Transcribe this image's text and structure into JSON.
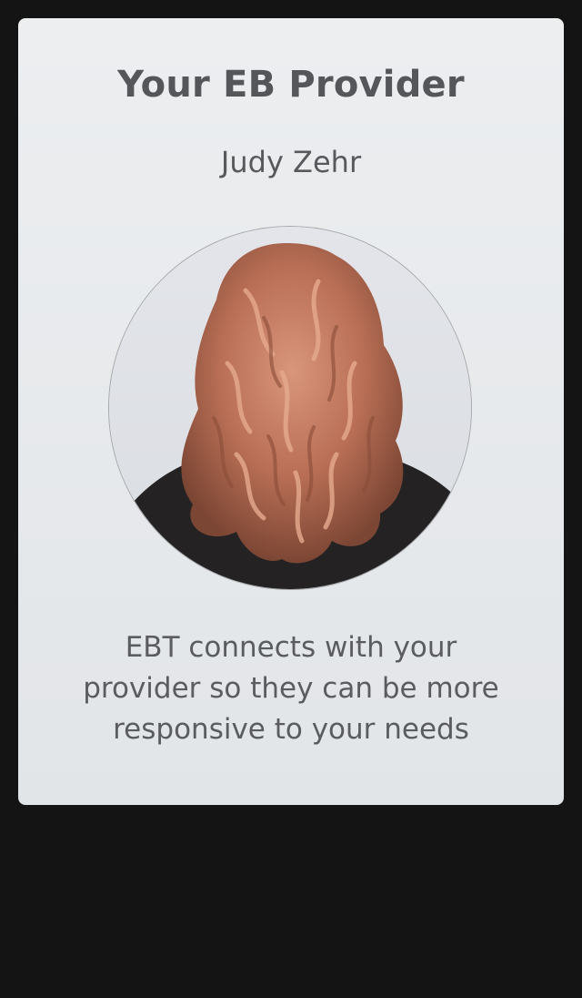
{
  "card": {
    "title": "Your EB Provider",
    "provider_name": "Judy Zehr",
    "photo_icon": "provider-photo",
    "description": "EBT connects with your provider so they can be more responsive to your needs"
  },
  "colors": {
    "background": "#141414",
    "card": "#e6e9eb",
    "text": "#555659"
  }
}
